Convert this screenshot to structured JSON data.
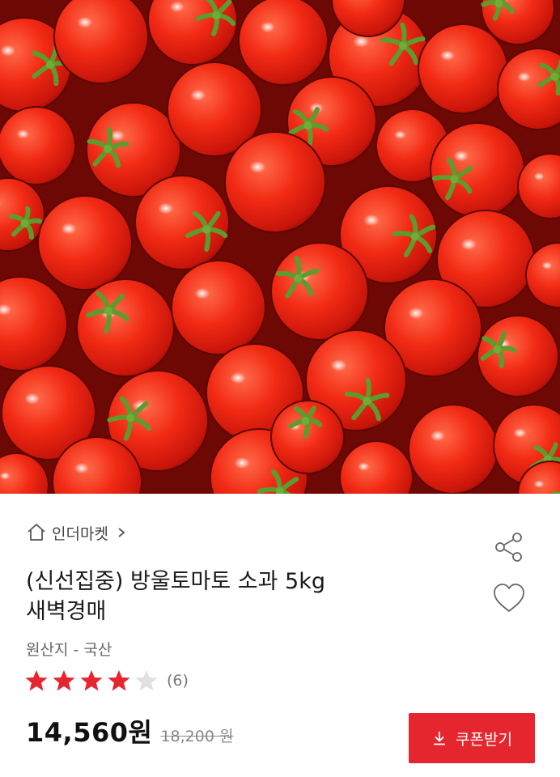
{
  "product": {
    "image_alt": "cherry tomatoes",
    "store_name": "인더마켓",
    "title_line1": "(신선집중) 방울토마토 소과 5kg",
    "title_line2": "새벽경매",
    "origin": "원산지 - 국산",
    "rating_stars": 4,
    "rating_max": 5,
    "review_count": "(6)",
    "price": "14,560원",
    "original_price": "18,200 원",
    "coupon_label": "쿠폰받기"
  },
  "icons": {
    "store": "home-icon",
    "store_link": "chevron-right-icon",
    "share": "share-icon",
    "wishlist": "heart-icon",
    "coupon": "download-icon",
    "rating": "star-icon"
  },
  "colors": {
    "accent": "#e5262f",
    "star_filled": "#e5262f",
    "star_empty": "#e0e0e0"
  }
}
